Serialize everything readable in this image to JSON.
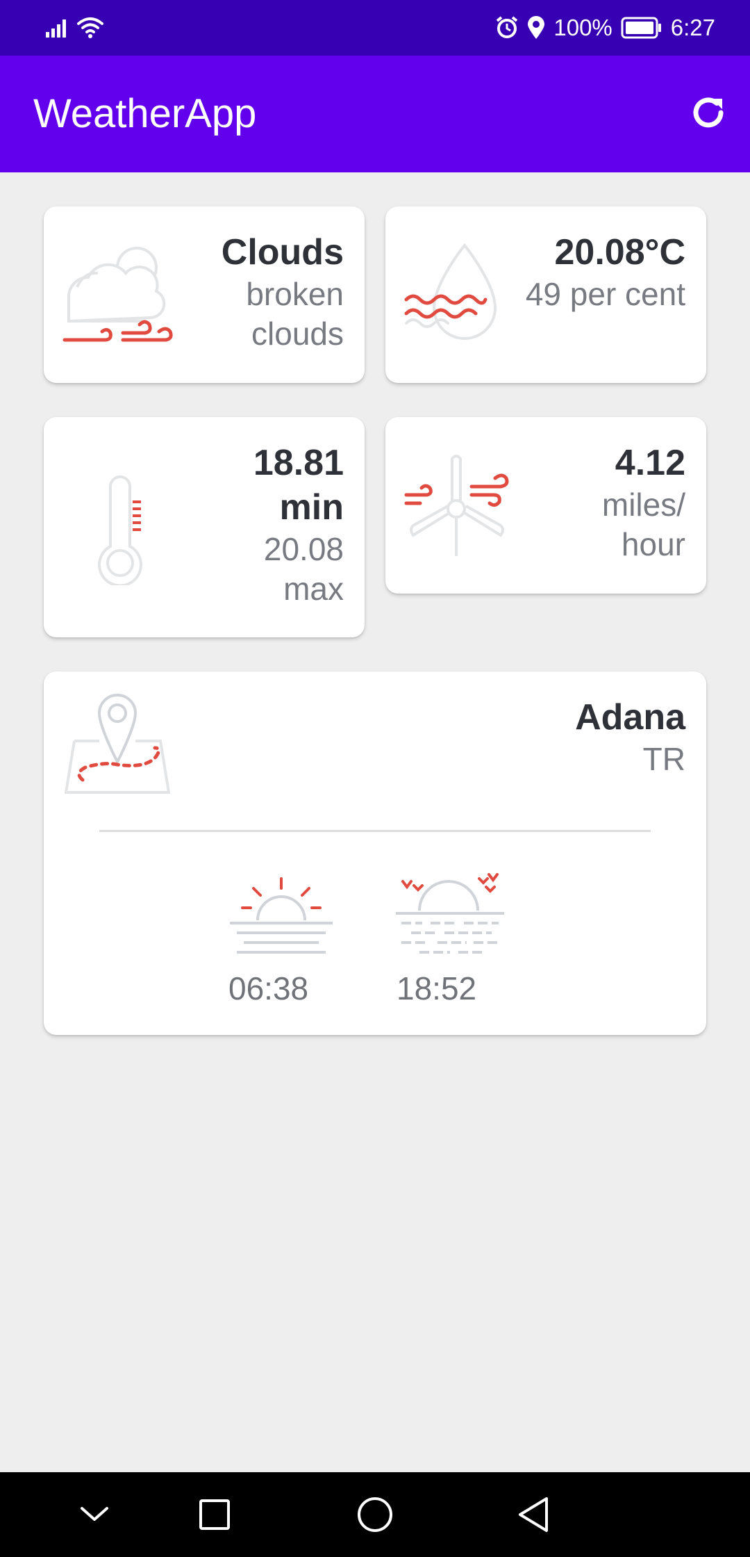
{
  "status_bar": {
    "battery": "100%",
    "time": "6:27"
  },
  "app_bar": {
    "title": "WeatherApp",
    "refresh_icon": "refresh-icon"
  },
  "weather": {
    "condition": "Clouds",
    "description": "broken clouds",
    "icon": "cloudy-wind-icon"
  },
  "humidity": {
    "temperature": "20.08°C",
    "value": "49 per cent",
    "icon": "humidity-drop-icon"
  },
  "temperature": {
    "min": "18.81 min",
    "max": "20.08 max",
    "icon": "thermometer-icon"
  },
  "wind": {
    "speed": "4.12",
    "unit": "miles/ hour",
    "icon": "wind-turbine-icon"
  },
  "location": {
    "city": "Adana",
    "country": "TR",
    "icon": "map-pin-icon",
    "sunrise": "06:38",
    "sunset": "18:52"
  },
  "colors": {
    "status_bar": "#3700b3",
    "app_bar": "#6200ee",
    "background": "#eeeeee",
    "accent": "#e04a3f"
  }
}
